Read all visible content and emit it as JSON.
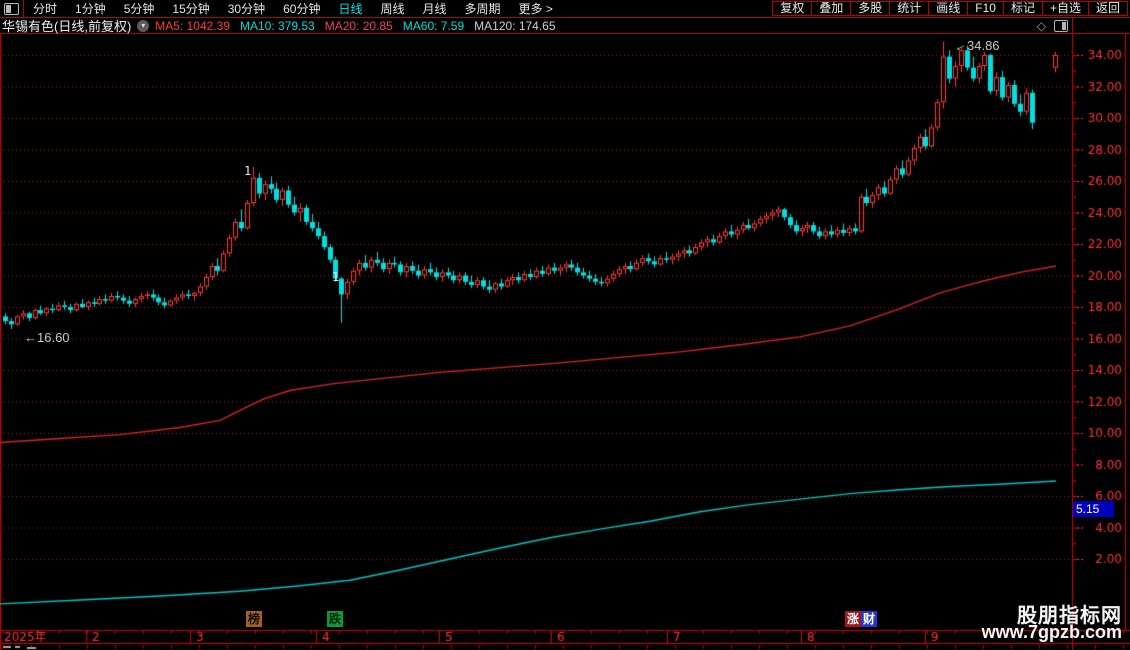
{
  "toolbar": {
    "periods": [
      "分时",
      "1分钟",
      "5分钟",
      "15分钟",
      "30分钟",
      "60分钟",
      "日线",
      "周线",
      "月线",
      "多周期",
      "更多 >"
    ],
    "active_period": "日线",
    "right_buttons": [
      "复权",
      "叠加",
      "多股",
      "统计",
      "画线",
      "F10",
      "标记",
      "+自选",
      "返回"
    ]
  },
  "title": {
    "name": "华锡有色(日线,前复权)",
    "ma": [
      {
        "label": "MA5: 1042.39",
        "color": "#ff3b3b"
      },
      {
        "label": "MA10: 379.53",
        "color": "#00dcdc"
      },
      {
        "label": "MA20: 20.85",
        "color": "#f23c64"
      },
      {
        "label": "MA60: 7.59",
        "color": "#00dcdc"
      },
      {
        "label": "MA120: 174.65",
        "color": "#cfcfcf"
      }
    ]
  },
  "colors": {
    "up": "#ff3b3b",
    "down": "#00e0e0",
    "grid": "#9e1e1e",
    "frame": "#d40000",
    "axis_text": "#ff3434",
    "ma_red": "#d92525",
    "ma_cyan": "#00c6c6"
  },
  "price_axis": {
    "min": 2,
    "max": 34,
    "step": 2,
    "cursor_value": "5.15"
  },
  "date_axis": {
    "year": "2025年",
    "months": [
      {
        "label": "2",
        "x": 92
      },
      {
        "label": "3",
        "x": 196
      },
      {
        "label": "4",
        "x": 322
      },
      {
        "label": "5",
        "x": 445
      },
      {
        "label": "6",
        "x": 557
      },
      {
        "label": "7",
        "x": 673
      },
      {
        "label": "8",
        "x": 807
      },
      {
        "label": "9",
        "x": 931
      }
    ]
  },
  "annotations": {
    "low_label": "←16.60",
    "peak_arrow": "←",
    "peak_label": "34.86",
    "marker1": "1",
    "marker2": "1"
  },
  "badges": {
    "bang": "榜",
    "die": "跌",
    "zhang": "涨",
    "cai": "财"
  },
  "watermark": {
    "line1": "股朋指标网",
    "line2": "www.7gpzb.com"
  },
  "chart_data": {
    "type": "candlestick",
    "title": "华锡有色 日线 前复权 2025年1月-9月",
    "ylim": [
      2,
      34
    ],
    "grid": "dotted-horizontal",
    "low_annotation": 16.6,
    "high_annotation": 34.86,
    "candles": [
      [
        17.4,
        17.6,
        16.9,
        17.1
      ],
      [
        17.1,
        17.3,
        16.6,
        16.9
      ],
      [
        16.9,
        17.5,
        16.8,
        17.4
      ],
      [
        17.4,
        17.8,
        17.2,
        17.6
      ],
      [
        17.6,
        17.7,
        17.1,
        17.3
      ],
      [
        17.3,
        17.9,
        17.2,
        17.8
      ],
      [
        17.8,
        18.1,
        17.5,
        17.6
      ],
      [
        17.6,
        18.0,
        17.4,
        17.9
      ],
      [
        17.9,
        18.2,
        17.6,
        17.8
      ],
      [
        17.8,
        18.3,
        17.7,
        18.1
      ],
      [
        18.1,
        18.4,
        17.8,
        18.0
      ],
      [
        18.0,
        18.2,
        17.6,
        17.8
      ],
      [
        17.8,
        18.3,
        17.7,
        18.2
      ],
      [
        18.2,
        18.5,
        17.9,
        18.0
      ],
      [
        18.0,
        18.4,
        17.8,
        18.3
      ],
      [
        18.3,
        18.6,
        18.0,
        18.2
      ],
      [
        18.2,
        18.7,
        18.1,
        18.5
      ],
      [
        18.5,
        18.8,
        18.2,
        18.4
      ],
      [
        18.4,
        18.9,
        18.3,
        18.7
      ],
      [
        18.7,
        19.0,
        18.4,
        18.6
      ],
      [
        18.6,
        18.8,
        18.2,
        18.4
      ],
      [
        18.4,
        18.7,
        18.0,
        18.2
      ],
      [
        18.2,
        18.6,
        18.0,
        18.5
      ],
      [
        18.5,
        18.9,
        18.3,
        18.7
      ],
      [
        18.7,
        19.0,
        18.5,
        18.8
      ],
      [
        18.8,
        19.1,
        18.4,
        18.6
      ],
      [
        18.6,
        18.8,
        18.1,
        18.3
      ],
      [
        18.3,
        18.6,
        17.9,
        18.1
      ],
      [
        18.1,
        18.5,
        18.0,
        18.4
      ],
      [
        18.4,
        18.8,
        18.2,
        18.6
      ],
      [
        18.6,
        19.0,
        18.4,
        18.8
      ],
      [
        18.8,
        19.1,
        18.5,
        18.7
      ],
      [
        18.7,
        19.0,
        18.4,
        18.9
      ],
      [
        18.9,
        19.5,
        18.7,
        19.3
      ],
      [
        19.3,
        20.1,
        19.1,
        19.9
      ],
      [
        19.9,
        20.8,
        19.7,
        20.6
      ],
      [
        20.6,
        21.1,
        20.0,
        20.3
      ],
      [
        20.3,
        21.6,
        20.2,
        21.4
      ],
      [
        21.4,
        22.6,
        21.2,
        22.4
      ],
      [
        22.4,
        23.6,
        22.2,
        23.4
      ],
      [
        23.4,
        24.2,
        22.8,
        23.0
      ],
      [
        23.0,
        24.8,
        22.9,
        24.6
      ],
      [
        24.6,
        26.9,
        24.4,
        26.2
      ],
      [
        26.2,
        26.5,
        24.9,
        25.2
      ],
      [
        25.2,
        26.0,
        24.8,
        25.8
      ],
      [
        25.8,
        26.3,
        25.2,
        25.5
      ],
      [
        25.5,
        25.9,
        24.6,
        24.8
      ],
      [
        24.8,
        25.6,
        24.4,
        25.4
      ],
      [
        25.4,
        25.7,
        24.3,
        24.5
      ],
      [
        24.5,
        25.0,
        23.8,
        24.0
      ],
      [
        24.0,
        24.6,
        23.4,
        24.3
      ],
      [
        24.3,
        24.5,
        23.2,
        23.4
      ],
      [
        23.4,
        23.9,
        22.8,
        23.0
      ],
      [
        23.0,
        23.4,
        22.3,
        22.5
      ],
      [
        22.5,
        22.8,
        21.6,
        21.8
      ],
      [
        21.8,
        22.0,
        20.8,
        21.0
      ],
      [
        21.0,
        21.2,
        19.6,
        19.8
      ],
      [
        19.8,
        19.9,
        17.0,
        18.8
      ],
      [
        18.8,
        19.8,
        18.5,
        19.6
      ],
      [
        19.6,
        20.5,
        19.4,
        20.3
      ],
      [
        20.3,
        21.0,
        20.0,
        20.8
      ],
      [
        20.8,
        21.3,
        20.3,
        20.5
      ],
      [
        20.5,
        21.2,
        20.2,
        21.0
      ],
      [
        21.0,
        21.5,
        20.6,
        20.8
      ],
      [
        20.8,
        21.1,
        20.2,
        20.4
      ],
      [
        20.4,
        21.0,
        20.1,
        20.8
      ],
      [
        20.8,
        21.2,
        20.5,
        20.7
      ],
      [
        20.7,
        20.9,
        20.0,
        20.2
      ],
      [
        20.2,
        20.8,
        19.9,
        20.6
      ],
      [
        20.6,
        20.9,
        20.1,
        20.3
      ],
      [
        20.3,
        20.7,
        19.8,
        20.0
      ],
      [
        20.0,
        20.6,
        19.8,
        20.4
      ],
      [
        20.4,
        20.8,
        20.0,
        20.2
      ],
      [
        20.2,
        20.5,
        19.7,
        19.9
      ],
      [
        19.9,
        20.4,
        19.6,
        20.2
      ],
      [
        20.2,
        20.5,
        19.8,
        20.0
      ],
      [
        20.0,
        20.3,
        19.5,
        19.7
      ],
      [
        19.7,
        20.2,
        19.5,
        20.0
      ],
      [
        20.0,
        20.2,
        19.4,
        19.6
      ],
      [
        19.6,
        20.0,
        19.2,
        19.4
      ],
      [
        19.4,
        19.9,
        19.2,
        19.7
      ],
      [
        19.7,
        19.9,
        19.1,
        19.3
      ],
      [
        19.3,
        19.7,
        18.9,
        19.1
      ],
      [
        19.1,
        19.6,
        18.9,
        19.5
      ],
      [
        19.5,
        19.8,
        19.1,
        19.3
      ],
      [
        19.3,
        19.9,
        19.2,
        19.7
      ],
      [
        19.7,
        20.1,
        19.4,
        19.9
      ],
      [
        19.9,
        20.2,
        19.5,
        19.7
      ],
      [
        19.7,
        20.3,
        19.6,
        20.1
      ],
      [
        20.1,
        20.4,
        19.7,
        19.9
      ],
      [
        19.9,
        20.5,
        19.8,
        20.3
      ],
      [
        20.3,
        20.6,
        19.9,
        20.1
      ],
      [
        20.1,
        20.7,
        20.0,
        20.5
      ],
      [
        20.5,
        20.8,
        20.1,
        20.3
      ],
      [
        20.3,
        20.7,
        20.0,
        20.5
      ],
      [
        20.5,
        20.9,
        20.2,
        20.7
      ],
      [
        20.7,
        21.0,
        20.3,
        20.5
      ],
      [
        20.5,
        20.8,
        20.0,
        20.2
      ],
      [
        20.2,
        20.5,
        19.8,
        20.0
      ],
      [
        20.0,
        20.3,
        19.6,
        19.8
      ],
      [
        19.8,
        20.1,
        19.4,
        19.6
      ],
      [
        19.6,
        19.9,
        19.3,
        19.5
      ],
      [
        19.5,
        20.0,
        19.3,
        19.8
      ],
      [
        19.8,
        20.3,
        19.6,
        20.1
      ],
      [
        20.1,
        20.6,
        19.9,
        20.4
      ],
      [
        20.4,
        20.8,
        20.1,
        20.6
      ],
      [
        20.6,
        20.9,
        20.2,
        20.4
      ],
      [
        20.4,
        21.0,
        20.3,
        20.8
      ],
      [
        20.8,
        21.3,
        20.6,
        21.1
      ],
      [
        21.1,
        21.4,
        20.7,
        20.9
      ],
      [
        20.9,
        21.2,
        20.5,
        20.7
      ],
      [
        20.7,
        21.3,
        20.6,
        21.1
      ],
      [
        21.1,
        21.5,
        20.8,
        21.0
      ],
      [
        21.0,
        21.4,
        20.7,
        21.2
      ],
      [
        21.2,
        21.6,
        20.9,
        21.4
      ],
      [
        21.4,
        21.8,
        21.1,
        21.6
      ],
      [
        21.6,
        21.9,
        21.2,
        21.4
      ],
      [
        21.4,
        22.0,
        21.3,
        21.8
      ],
      [
        21.8,
        22.3,
        21.6,
        22.1
      ],
      [
        22.1,
        22.5,
        21.8,
        22.3
      ],
      [
        22.3,
        22.6,
        21.9,
        22.1
      ],
      [
        22.1,
        22.7,
        22.0,
        22.5
      ],
      [
        22.5,
        23.0,
        22.3,
        22.8
      ],
      [
        22.8,
        23.2,
        22.4,
        22.6
      ],
      [
        22.6,
        23.1,
        22.3,
        22.9
      ],
      [
        22.9,
        23.4,
        22.7,
        23.2
      ],
      [
        23.2,
        23.6,
        22.9,
        23.0
      ],
      [
        23.0,
        23.5,
        22.8,
        23.3
      ],
      [
        23.3,
        23.8,
        23.1,
        23.6
      ],
      [
        23.6,
        24.0,
        23.3,
        23.8
      ],
      [
        23.8,
        24.2,
        23.5,
        24.0
      ],
      [
        24.0,
        24.4,
        23.7,
        24.2
      ],
      [
        24.2,
        24.3,
        23.5,
        23.7
      ],
      [
        23.7,
        23.9,
        23.0,
        23.2
      ],
      [
        23.2,
        23.5,
        22.6,
        22.8
      ],
      [
        22.8,
        23.2,
        22.5,
        23.0
      ],
      [
        23.0,
        23.4,
        22.7,
        23.2
      ],
      [
        23.2,
        23.4,
        22.6,
        22.8
      ],
      [
        22.8,
        23.1,
        22.3,
        22.5
      ],
      [
        22.5,
        23.0,
        22.3,
        22.8
      ],
      [
        22.8,
        23.2,
        22.4,
        22.6
      ],
      [
        22.6,
        23.1,
        22.4,
        22.9
      ],
      [
        22.9,
        23.3,
        22.5,
        22.7
      ],
      [
        22.7,
        23.2,
        22.5,
        23.0
      ],
      [
        23.0,
        23.3,
        22.6,
        22.8
      ],
      [
        22.8,
        25.2,
        22.7,
        25.0
      ],
      [
        25.0,
        25.5,
        24.4,
        24.6
      ],
      [
        24.6,
        25.3,
        24.3,
        25.1
      ],
      [
        25.1,
        25.8,
        24.8,
        25.6
      ],
      [
        25.6,
        26.0,
        25.0,
        25.2
      ],
      [
        25.2,
        26.3,
        25.1,
        26.1
      ],
      [
        26.1,
        27.0,
        25.8,
        26.8
      ],
      [
        26.8,
        27.3,
        26.2,
        26.4
      ],
      [
        26.4,
        27.5,
        26.3,
        27.3
      ],
      [
        27.3,
        28.3,
        27.0,
        28.1
      ],
      [
        28.1,
        29.0,
        27.8,
        28.8
      ],
      [
        28.8,
        29.3,
        28.0,
        28.2
      ],
      [
        28.2,
        29.6,
        28.1,
        29.4
      ],
      [
        29.4,
        31.2,
        29.2,
        31.0
      ],
      [
        31.0,
        34.86,
        30.6,
        33.9
      ],
      [
        33.9,
        34.3,
        32.2,
        32.5
      ],
      [
        32.5,
        33.6,
        32.0,
        33.3
      ],
      [
        33.3,
        34.5,
        32.9,
        34.3
      ],
      [
        34.3,
        34.6,
        33.0,
        33.2
      ],
      [
        33.2,
        33.9,
        32.3,
        32.5
      ],
      [
        32.5,
        33.5,
        32.2,
        33.3
      ],
      [
        33.3,
        34.2,
        33.0,
        34.0
      ],
      [
        34.0,
        34.1,
        31.5,
        31.7
      ],
      [
        31.7,
        32.9,
        31.4,
        32.6
      ],
      [
        32.6,
        33.0,
        31.1,
        31.3
      ],
      [
        31.3,
        32.3,
        31.0,
        32.1
      ],
      [
        32.1,
        32.4,
        30.7,
        30.9
      ],
      [
        30.9,
        31.5,
        30.1,
        30.4
      ],
      [
        30.4,
        31.9,
        30.2,
        31.6
      ],
      [
        31.6,
        31.8,
        29.3,
        29.7
      ],
      null,
      null,
      null,
      [
        33.2,
        34.2,
        32.9,
        34.0
      ]
    ],
    "series": [
      {
        "name": "MA-red",
        "color": "#d92525",
        "points": [
          [
            0,
            9.4
          ],
          [
            60,
            9.65
          ],
          [
            120,
            9.9
          ],
          [
            180,
            10.35
          ],
          [
            220,
            10.8
          ],
          [
            245,
            11.6
          ],
          [
            265,
            12.2
          ],
          [
            290,
            12.7
          ],
          [
            330,
            13.1
          ],
          [
            380,
            13.45
          ],
          [
            440,
            13.85
          ],
          [
            500,
            14.15
          ],
          [
            560,
            14.45
          ],
          [
            620,
            14.8
          ],
          [
            680,
            15.15
          ],
          [
            740,
            15.6
          ],
          [
            800,
            16.1
          ],
          [
            850,
            16.8
          ],
          [
            900,
            17.9
          ],
          [
            940,
            18.9
          ],
          [
            980,
            19.6
          ],
          [
            1020,
            20.2
          ],
          [
            1056,
            20.6
          ]
        ]
      },
      {
        "name": "MA-cyan",
        "color": "#00c6c6",
        "points": [
          [
            0,
            -0.85
          ],
          [
            80,
            -0.6
          ],
          [
            160,
            -0.35
          ],
          [
            240,
            -0.05
          ],
          [
            300,
            0.3
          ],
          [
            350,
            0.65
          ],
          [
            400,
            1.3
          ],
          [
            450,
            2.0
          ],
          [
            500,
            2.7
          ],
          [
            550,
            3.35
          ],
          [
            600,
            3.9
          ],
          [
            650,
            4.4
          ],
          [
            700,
            5.0
          ],
          [
            750,
            5.45
          ],
          [
            800,
            5.8
          ],
          [
            850,
            6.15
          ],
          [
            900,
            6.4
          ],
          [
            950,
            6.6
          ],
          [
            1000,
            6.75
          ],
          [
            1056,
            6.95
          ]
        ]
      }
    ]
  }
}
